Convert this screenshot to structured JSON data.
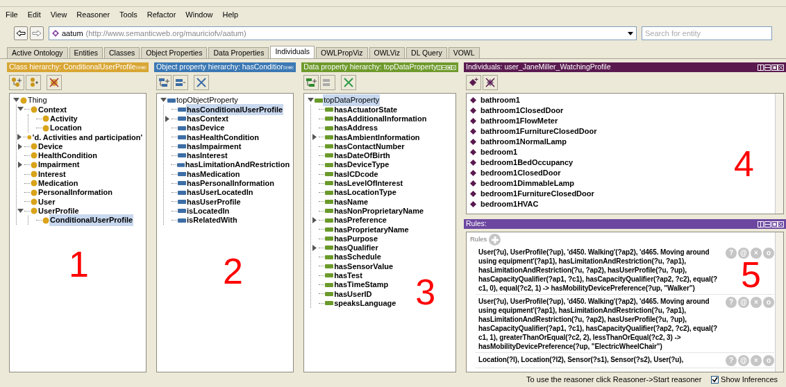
{
  "menu": [
    "File",
    "Edit",
    "View",
    "Reasoner",
    "Tools",
    "Refactor",
    "Window",
    "Help"
  ],
  "address_bar": {
    "ontology_name": "aatum",
    "ontology_iri": "(http://www.semanticweb.org/mauriciofv/aatum)",
    "search_placeholder": "Search for entity"
  },
  "tabs": [
    {
      "label": "Active Ontology",
      "selected": false
    },
    {
      "label": "Entities",
      "selected": false
    },
    {
      "label": "Classes",
      "selected": false
    },
    {
      "label": "Object Properties",
      "selected": false
    },
    {
      "label": "Data Properties",
      "selected": false
    },
    {
      "label": "Individuals",
      "selected": true
    },
    {
      "label": "OWLPropViz",
      "selected": false
    },
    {
      "label": "OWLViz",
      "selected": false
    },
    {
      "label": "DL Query",
      "selected": false
    },
    {
      "label": "VOWL",
      "selected": false
    }
  ],
  "class_hierarchy": {
    "title": "Class hierarchy: ConditionalUserProfile",
    "annotation": "1",
    "tree": [
      {
        "label": "Thing",
        "expanded": true,
        "selected": false,
        "children": [
          {
            "label": "Context",
            "expanded": true,
            "selected": false,
            "children": [
              {
                "label": "Activity",
                "selected": false
              },
              {
                "label": "Location",
                "selected": false
              }
            ]
          },
          {
            "label": "'d. Activities and participation'",
            "expanded": false,
            "selected": false
          },
          {
            "label": "Device",
            "expanded": false,
            "selected": false
          },
          {
            "label": "HealthCondition",
            "selected": false
          },
          {
            "label": "Impairment",
            "expanded": false,
            "selected": false
          },
          {
            "label": "Interest",
            "selected": false
          },
          {
            "label": "Medication",
            "selected": false
          },
          {
            "label": "PersonalInformation",
            "selected": false
          },
          {
            "label": "User",
            "selected": false
          },
          {
            "label": "UserProfile",
            "expanded": true,
            "selected": false,
            "children": [
              {
                "label": "ConditionalUserProfile",
                "selected": true
              }
            ]
          }
        ]
      }
    ]
  },
  "object_property_hierarchy": {
    "title": "Object property hierarchy: hasConditior",
    "annotation": "2",
    "tree": [
      {
        "label": "topObjectProperty",
        "expanded": true,
        "selected": false,
        "children": [
          {
            "label": "hasConditionalUserProfile",
            "selected": true
          },
          {
            "label": "hasContext",
            "expanded": false,
            "selected": false
          },
          {
            "label": "hasDevice",
            "selected": false
          },
          {
            "label": "hasHealthCondition",
            "selected": false
          },
          {
            "label": "hasImpairment",
            "selected": false
          },
          {
            "label": "hasInterest",
            "selected": false
          },
          {
            "label": "hasLimitationAndRestriction",
            "selected": false
          },
          {
            "label": "hasMedication",
            "selected": false
          },
          {
            "label": "hasPersonalInformation",
            "selected": false
          },
          {
            "label": "hasUserLocatedIn",
            "selected": false
          },
          {
            "label": "hasUserProfile",
            "selected": false
          },
          {
            "label": "isLocatedIn",
            "selected": false
          },
          {
            "label": "isRelatedWith",
            "selected": false
          }
        ]
      }
    ]
  },
  "data_property_hierarchy": {
    "title": "Data property hierarchy: topDataProperty",
    "annotation": "3",
    "tree": [
      {
        "label": "topDataProperty",
        "expanded": true,
        "selected": true,
        "children": [
          {
            "label": "hasActuatorState",
            "selected": false
          },
          {
            "label": "hasAdditionalInformation",
            "selected": false
          },
          {
            "label": "hasAddress",
            "selected": false
          },
          {
            "label": "hasAmbientInformation",
            "expanded": false,
            "selected": false
          },
          {
            "label": "hasContactNumber",
            "selected": false
          },
          {
            "label": "hasDateOfBirth",
            "selected": false
          },
          {
            "label": "hasDeviceType",
            "selected": false
          },
          {
            "label": "hasICDcode",
            "selected": false
          },
          {
            "label": "hasLevelOfInterest",
            "selected": false
          },
          {
            "label": "hasLocationType",
            "selected": false
          },
          {
            "label": "hasName",
            "selected": false
          },
          {
            "label": "hasNonProprietaryName",
            "selected": false
          },
          {
            "label": "hasPreference",
            "expanded": false,
            "selected": false
          },
          {
            "label": "hasProprietaryName",
            "selected": false
          },
          {
            "label": "hasPurpose",
            "selected": false
          },
          {
            "label": "hasQualifier",
            "expanded": false,
            "selected": false
          },
          {
            "label": "hasSchedule",
            "selected": false
          },
          {
            "label": "hasSensorValue",
            "selected": false
          },
          {
            "label": "hasTest",
            "selected": false
          },
          {
            "label": "hasTimeStamp",
            "selected": false
          },
          {
            "label": "hasUserID",
            "selected": false
          },
          {
            "label": "speaksLanguage",
            "selected": false
          }
        ]
      }
    ]
  },
  "individuals": {
    "title": "Individuals: user_JaneMiller_WatchingProfile",
    "annotation": "4",
    "items": [
      "bathroom1",
      "bathroom1ClosedDoor",
      "bathroom1FlowMeter",
      "bathroom1FurnitureClosedDoor",
      "bathroom1NormalLamp",
      "bedroom1",
      "bedroom1BedOccupancy",
      "bedroom1ClosedDoor",
      "bedroom1DimmableLamp",
      "bedroom1FurnitureClosedDoor",
      "bedroom1HVAC"
    ]
  },
  "rules": {
    "title": "Rules:",
    "label": "Rules",
    "annotation": "5",
    "items": [
      {
        "text": "User(?u), UserProfile(?up), 'd450. Walking'(?ap2), 'd465. Moving around using equipment'(?ap1), hasLimitationAndRestriction(?u, ?ap1), hasLimitationAndRestriction(?u, ?ap2), hasUserProfile(?u, ?up), hasCapacityQualifier(?ap1, ?c1), hasCapacityQualifier(?ap2, ?c2), equal(?c1, 0), equal(?c2, 1) -> hasMobilityDevicePreference(?up, \"Walker\")",
        "actions": [
          "?",
          "@",
          "×",
          "o"
        ]
      },
      {
        "text": "User(?u), UserProfile(?up), 'd450. Walking'(?ap2), 'd465. Moving around using equipment'(?ap1), hasLimitationAndRestriction(?u, ?ap1), hasLimitationAndRestriction(?u, ?ap2), hasUserProfile(?u, ?up), hasCapacityQualifier(?ap1, ?c1), hasCapacityQualifier(?ap2, ?c2), equal(?c1, 1), greaterThanOrEqual(?c2, 2), lessThanOrEqual(?c2, 3) -> hasMobilityDevicePreference(?up, \"ElectricWheelChair\")",
        "actions": [
          "?",
          "@",
          "×",
          "o"
        ]
      },
      {
        "text": "Location(?l), Location(?l2), Sensor(?s1), Sensor(?s2), User(?u),",
        "actions": [
          "?",
          "@",
          "×",
          "o"
        ]
      }
    ]
  },
  "status_bar": {
    "message": "To use the reasoner click Reasoner->Start reasoner",
    "show_inferences": {
      "label": "Show Inferences",
      "checked": true
    }
  }
}
